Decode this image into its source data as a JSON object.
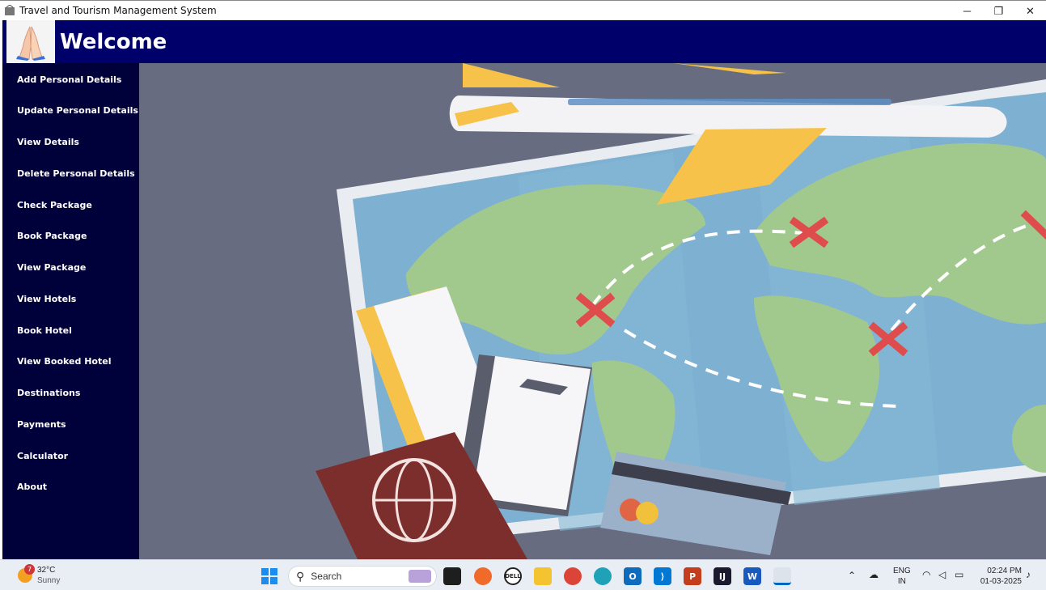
{
  "window": {
    "title": "Travel and Tourism Management System",
    "controls": {
      "minimize": "─",
      "maximize": "❐",
      "close": "✕"
    }
  },
  "header": {
    "welcome": "Welcome",
    "logo_icon": "praying-hands-icon",
    "bg_color": "#00006b"
  },
  "sidebar": {
    "bg_color": "#00003a",
    "items": [
      {
        "label": "Add Personal Details"
      },
      {
        "label": "Update Personal Details"
      },
      {
        "label": "View Details"
      },
      {
        "label": "Delete Personal Details"
      },
      {
        "label": "Check Package"
      },
      {
        "label": "Book Package"
      },
      {
        "label": "View Package"
      },
      {
        "label": "View Hotels"
      },
      {
        "label": "Book Hotel"
      },
      {
        "label": "View Booked Hotel"
      },
      {
        "label": "Destinations"
      },
      {
        "label": "Payments"
      },
      {
        "label": "Calculator"
      },
      {
        "label": "About"
      }
    ]
  },
  "main": {
    "image": "travel-illustration-world-map-plane-tickets-passport-card"
  },
  "taskbar": {
    "weather": {
      "badge": "7",
      "temp": "32°C",
      "condition": "Sunny"
    },
    "search_label": "Search",
    "tray": {
      "lang_top": "ENG",
      "lang_bottom": "IN"
    },
    "clock": {
      "time": "02:24 PM",
      "date": "01-03-2025"
    }
  }
}
